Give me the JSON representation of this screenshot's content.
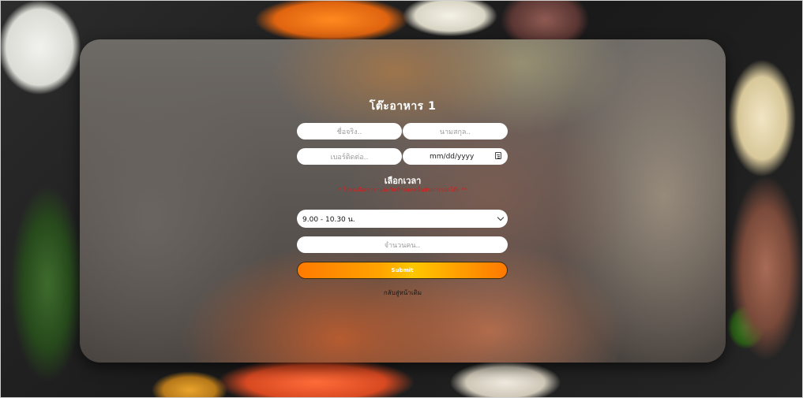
{
  "form": {
    "title": "โต๊ะอาหาร 1",
    "first_name_placeholder": "ชื่อจริง..",
    "last_name_placeholder": "นามสกุล..",
    "phone_placeholder": "เบอร์ติดต่อ..",
    "date_value": "mm/dd/yyyy",
    "time_section_title": "เลือกเวลา",
    "time_warning": "* โปรดเลือกเวลาและวันที่ก่อนกดยืนยันการจองโต๊ะ **",
    "time_selected": "9.00 - 10.30 น.",
    "guests_placeholder": "จำนวนคน..",
    "submit_label": "Submit",
    "back_label": "กลับสู่หน้าเดิม"
  },
  "colors": {
    "warning": "#e01818",
    "submit_gradient_start": "#ff7a00",
    "submit_gradient_mid": "#ffc700"
  },
  "icons": {
    "date": "calendar-icon",
    "select": "chevron-down-icon"
  }
}
